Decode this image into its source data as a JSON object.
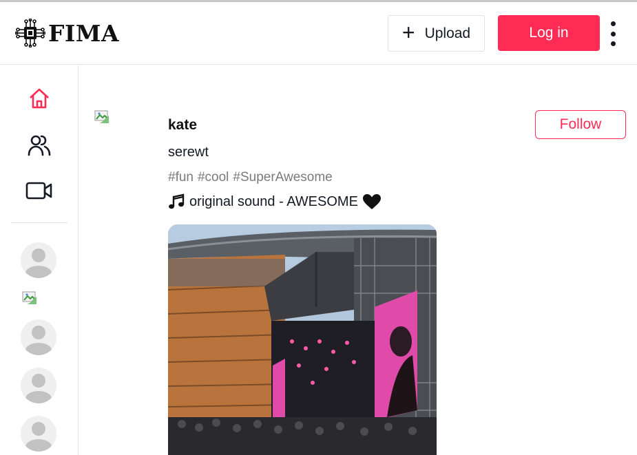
{
  "header": {
    "logo_text": "FIMA",
    "upload_label": "Upload",
    "login_label": "Log in"
  },
  "sidebar": {
    "nav": [
      {
        "icon": "home-icon",
        "active": true
      },
      {
        "icon": "following-icon",
        "active": false
      },
      {
        "icon": "live-video-icon",
        "active": false
      }
    ]
  },
  "post": {
    "username": "kate",
    "caption": "serewt",
    "hashtags": [
      "#fun",
      "#cool",
      "#SuperAwesome"
    ],
    "sound": "original sound - AWESOME",
    "follow_label": "Follow"
  },
  "colors": {
    "accent": "#fe2c55",
    "text": "#161823",
    "muted": "#7a7a7e"
  }
}
